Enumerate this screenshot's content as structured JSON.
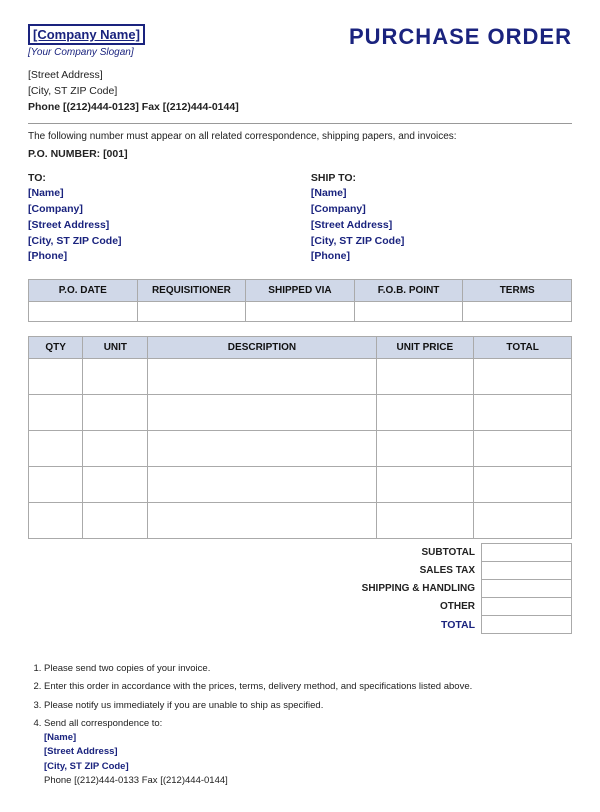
{
  "header": {
    "company_name": "[Company Name]",
    "company_slogan": "[Your Company Slogan]",
    "title": "PURCHASE ORDER"
  },
  "address": {
    "street": "[Street Address]",
    "city_state_zip": "[City, ST  ZIP Code]",
    "phone_fax": "Phone [(212)444-0123]    Fax [(212)444-0144]"
  },
  "notice": {
    "text": "The following number must appear on all related correspondence, shipping papers, and invoices:",
    "po_number_label": "P.O. NUMBER: [001]"
  },
  "to": {
    "label": "TO:",
    "name": "[Name]",
    "company": "[Company]",
    "street": "[Street Address]",
    "city_state_zip": "[City, ST  ZIP Code]",
    "phone": "[Phone]"
  },
  "ship_to": {
    "label": "SHIP TO:",
    "name": "[Name]",
    "company": "[Company]",
    "street": "[Street Address]",
    "city_state_zip": "[City, ST  ZIP Code]",
    "phone": "[Phone]"
  },
  "po_info_table": {
    "headers": [
      "P.O. DATE",
      "REQUISITIONER",
      "SHIPPED VIA",
      "F.O.B. POINT",
      "TERMS"
    ]
  },
  "line_items_table": {
    "headers": [
      "QTY",
      "UNIT",
      "DESCRIPTION",
      "UNIT PRICE",
      "TOTAL"
    ],
    "rows": [
      {
        "qty": "",
        "unit": "",
        "desc": "",
        "price": "",
        "total": ""
      },
      {
        "qty": "",
        "unit": "",
        "desc": "",
        "price": "",
        "total": ""
      },
      {
        "qty": "",
        "unit": "",
        "desc": "",
        "price": "",
        "total": ""
      },
      {
        "qty": "",
        "unit": "",
        "desc": "",
        "price": "",
        "total": ""
      },
      {
        "qty": "",
        "unit": "",
        "desc": "",
        "price": "",
        "total": ""
      }
    ]
  },
  "totals": {
    "subtotal_label": "SUBTOTAL",
    "sales_tax_label": "SALES TAX",
    "shipping_label": "SHIPPING & HANDLING",
    "other_label": "OTHER",
    "total_label": "TotAL"
  },
  "terms": {
    "items": [
      "Please send two copies of your invoice.",
      "Enter this order in accordance with the prices, terms, delivery method, and specifications  listed above.",
      "Please notify us immediately if you are unable to ship as specified.",
      "Send all correspondence to:"
    ],
    "contact": {
      "name": "[Name]",
      "street": "[Street Address]",
      "city_state_zip": "[City, ST  ZIP Code]",
      "phone_fax": "Phone [(212)444-0133    Fax [(212)444-0144]"
    }
  }
}
